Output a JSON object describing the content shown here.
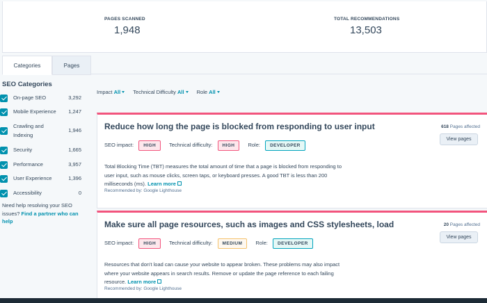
{
  "stats": {
    "pages_scanned_label": "PAGES SCANNED",
    "pages_scanned_value": "1,948",
    "total_recs_label": "TOTAL RECOMMENDATIONS",
    "total_recs_value": "13,503"
  },
  "tabs": [
    {
      "label": "Categories",
      "active": true
    },
    {
      "label": "Pages",
      "active": false
    }
  ],
  "sidebar": {
    "title": "SEO Categories",
    "items": [
      {
        "label": "On-page SEO",
        "count": "3,292"
      },
      {
        "label": "Mobile Experience",
        "count": "1,247"
      },
      {
        "label": "Crawling and",
        "label2": "Indexing",
        "count": "1,946"
      },
      {
        "label": "Security",
        "count": "1,665"
      },
      {
        "label": "Performance",
        "count": "3,957"
      },
      {
        "label": "User Experience",
        "count": "1,396"
      },
      {
        "label": "Accessibility",
        "count": "0"
      }
    ],
    "help_text": "Need help resolving your SEO issues?",
    "help_link": "Find a partner who can help"
  },
  "filters": {
    "impact_label": "Impact",
    "impact_value": "All",
    "difficulty_label": "Technical Difficulty",
    "difficulty_value": "All",
    "role_label": "Role",
    "role_value": "All"
  },
  "cards": [
    {
      "title": "Reduce how long the page is blocked from responding to user input",
      "seo_impact_label": "SEO impact:",
      "seo_impact": "HIGH",
      "difficulty_label": "Technical difficulty:",
      "difficulty": "HIGH",
      "role_label": "Role:",
      "role": "DEVELOPER",
      "description": "Total Blocking Time (TBT) measures the total amount of time that a page is blocked from responding to user input, such as mouse clicks, screen taps, or keyboard presses. A good TBT is less than 200 milliseconds (ms).",
      "learn_more": "Learn more",
      "recommended_by": "Recommended by: Google Lighthouse",
      "pages_count": "618",
      "pages_affected_label": "Pages affected",
      "view_pages": "View pages"
    },
    {
      "title": "Make sure all page resources, such as images and CSS stylesheets, load",
      "seo_impact_label": "SEO impact:",
      "seo_impact": "HIGH",
      "difficulty_label": "Technical difficulty:",
      "difficulty": "MEDIUM",
      "role_label": "Role:",
      "role": "DEVELOPER",
      "description": "Resources that don't load can cause your website to appear broken. These problems may also impact where your website appears in search results. Remove or update the page reference to each failing resource.",
      "learn_more": "Learn more",
      "recommended_by": "Recommended by: Google Lighthouse",
      "pages_count": "20",
      "pages_affected_label": "Pages affected",
      "view_pages": "View pages"
    }
  ]
}
